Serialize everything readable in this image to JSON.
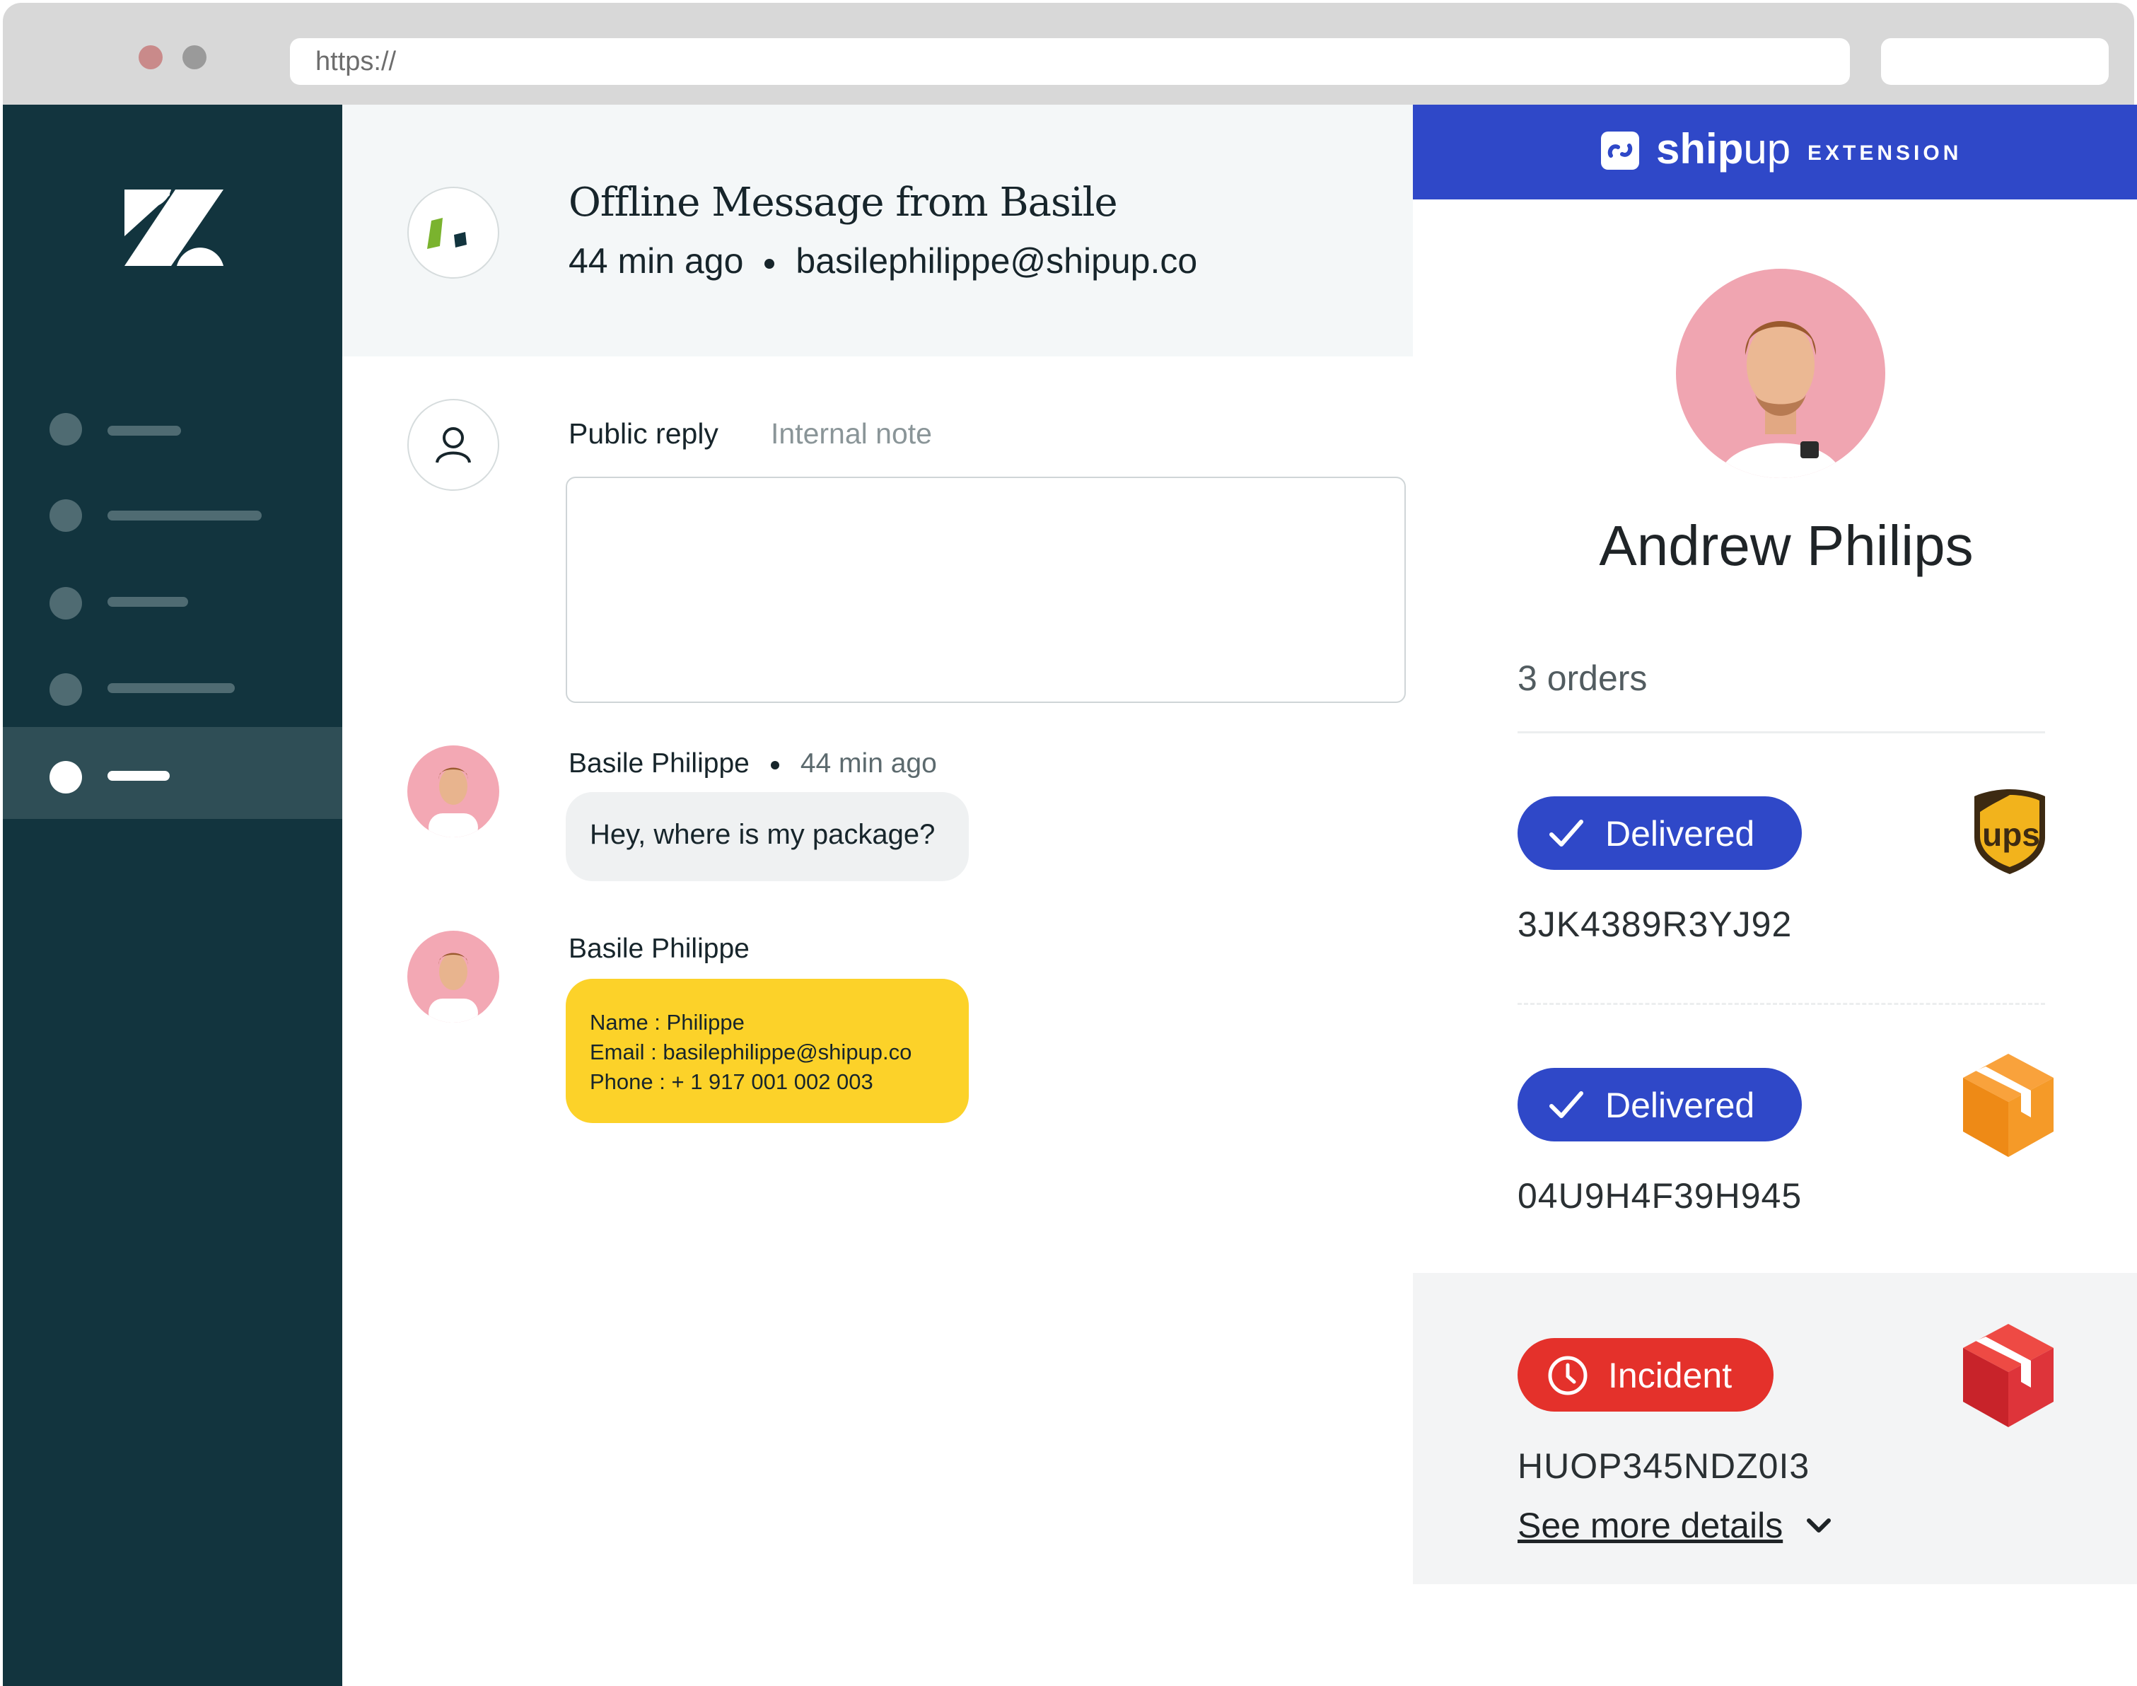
{
  "browser": {
    "url": "https://"
  },
  "ticket": {
    "title": "Offline Message from Basile",
    "time_ago": "44 min ago",
    "email": "basilephilippe@shipup.co"
  },
  "composer": {
    "tab_public": "Public reply",
    "tab_internal": "Internal note",
    "reply_value": ""
  },
  "messages": [
    {
      "author": "Basile Philippe",
      "time": "44 min ago",
      "text": "Hey, where is my package?"
    },
    {
      "author": "Basile Philippe",
      "lines": [
        "Name : Philippe",
        "Email : basilephilippe@shipup.co",
        "Phone : + 1 917 001 002 003"
      ]
    }
  ],
  "extension": {
    "brand_bold": "ship",
    "brand_light": "up",
    "label": "EXTENSION",
    "customer_name": "Andrew Philips",
    "orders_count": "3 orders",
    "orders": [
      {
        "status": "Delivered",
        "tracking": "3JK4389R3YJ92",
        "carrier": "UPS",
        "status_color": "#2f48c8",
        "status_icon": "check-icon",
        "carrier_icon": "ups-shield-icon"
      },
      {
        "status": "Delivered",
        "tracking": "04U9H4F39H945",
        "carrier": "package",
        "status_color": "#2f48c8",
        "status_icon": "check-icon",
        "carrier_icon": "orange-box-icon"
      },
      {
        "status": "Incident",
        "tracking": "HUOP345NDZ0I3",
        "carrier": "package",
        "status_color": "#e4312b",
        "status_icon": "clock-icon",
        "carrier_icon": "red-box-icon"
      }
    ],
    "see_more": "See more details"
  },
  "colors": {
    "sidebar": "#12343e",
    "brand_blue": "#2f48c8",
    "incident_red": "#e4312b",
    "note_yellow": "#fcd229"
  }
}
